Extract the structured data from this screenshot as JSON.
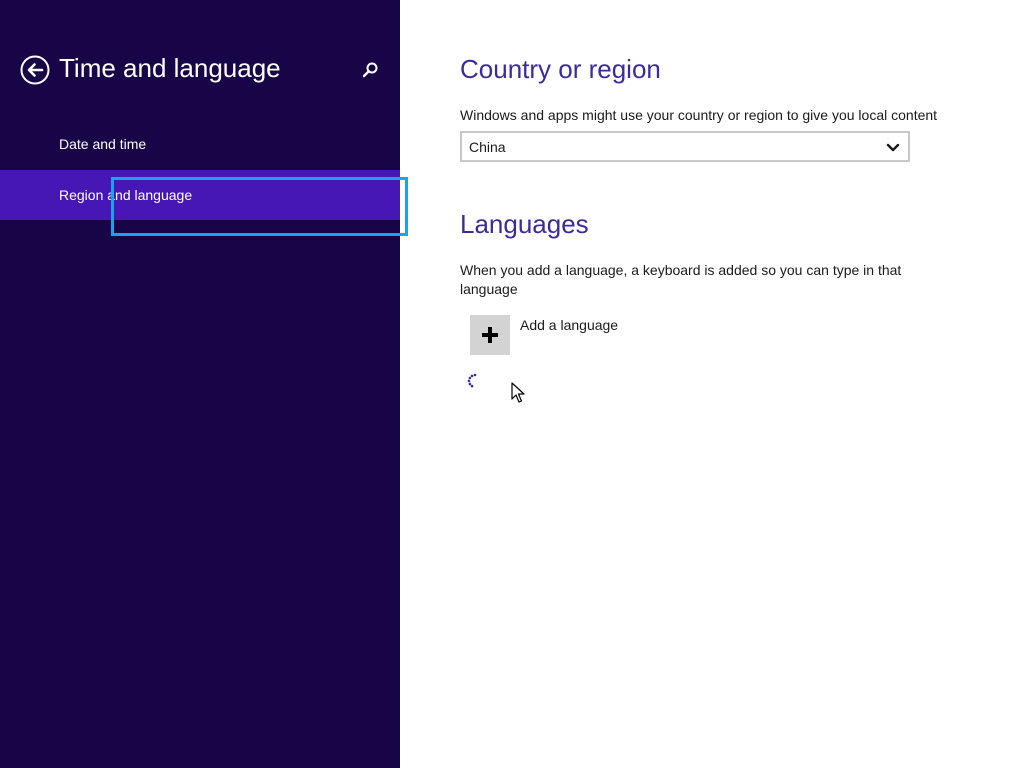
{
  "nav": {
    "title": "Time and language",
    "back_icon": "back-arrow-icon",
    "search_icon": "search-icon",
    "items": [
      {
        "label": "Date and time",
        "selected": false
      },
      {
        "label": "Region and language",
        "selected": true
      }
    ]
  },
  "country_section": {
    "heading": "Country or region",
    "description": "Windows and apps might use your country or region to give you local content",
    "selected_country": "China",
    "dropdown_icon": "chevron-down-icon"
  },
  "languages_section": {
    "heading": "Languages",
    "description": "When you add a language, a keyboard is added so you can type in that language",
    "add_label": "Add a language",
    "add_icon": "plus-icon",
    "loading_icon": "spinner-icon"
  },
  "colors": {
    "nav_background": "#180548",
    "nav_selected": "#4617b4",
    "heading": "#3a2b9f",
    "focus_outline": "#1aa3e8"
  }
}
